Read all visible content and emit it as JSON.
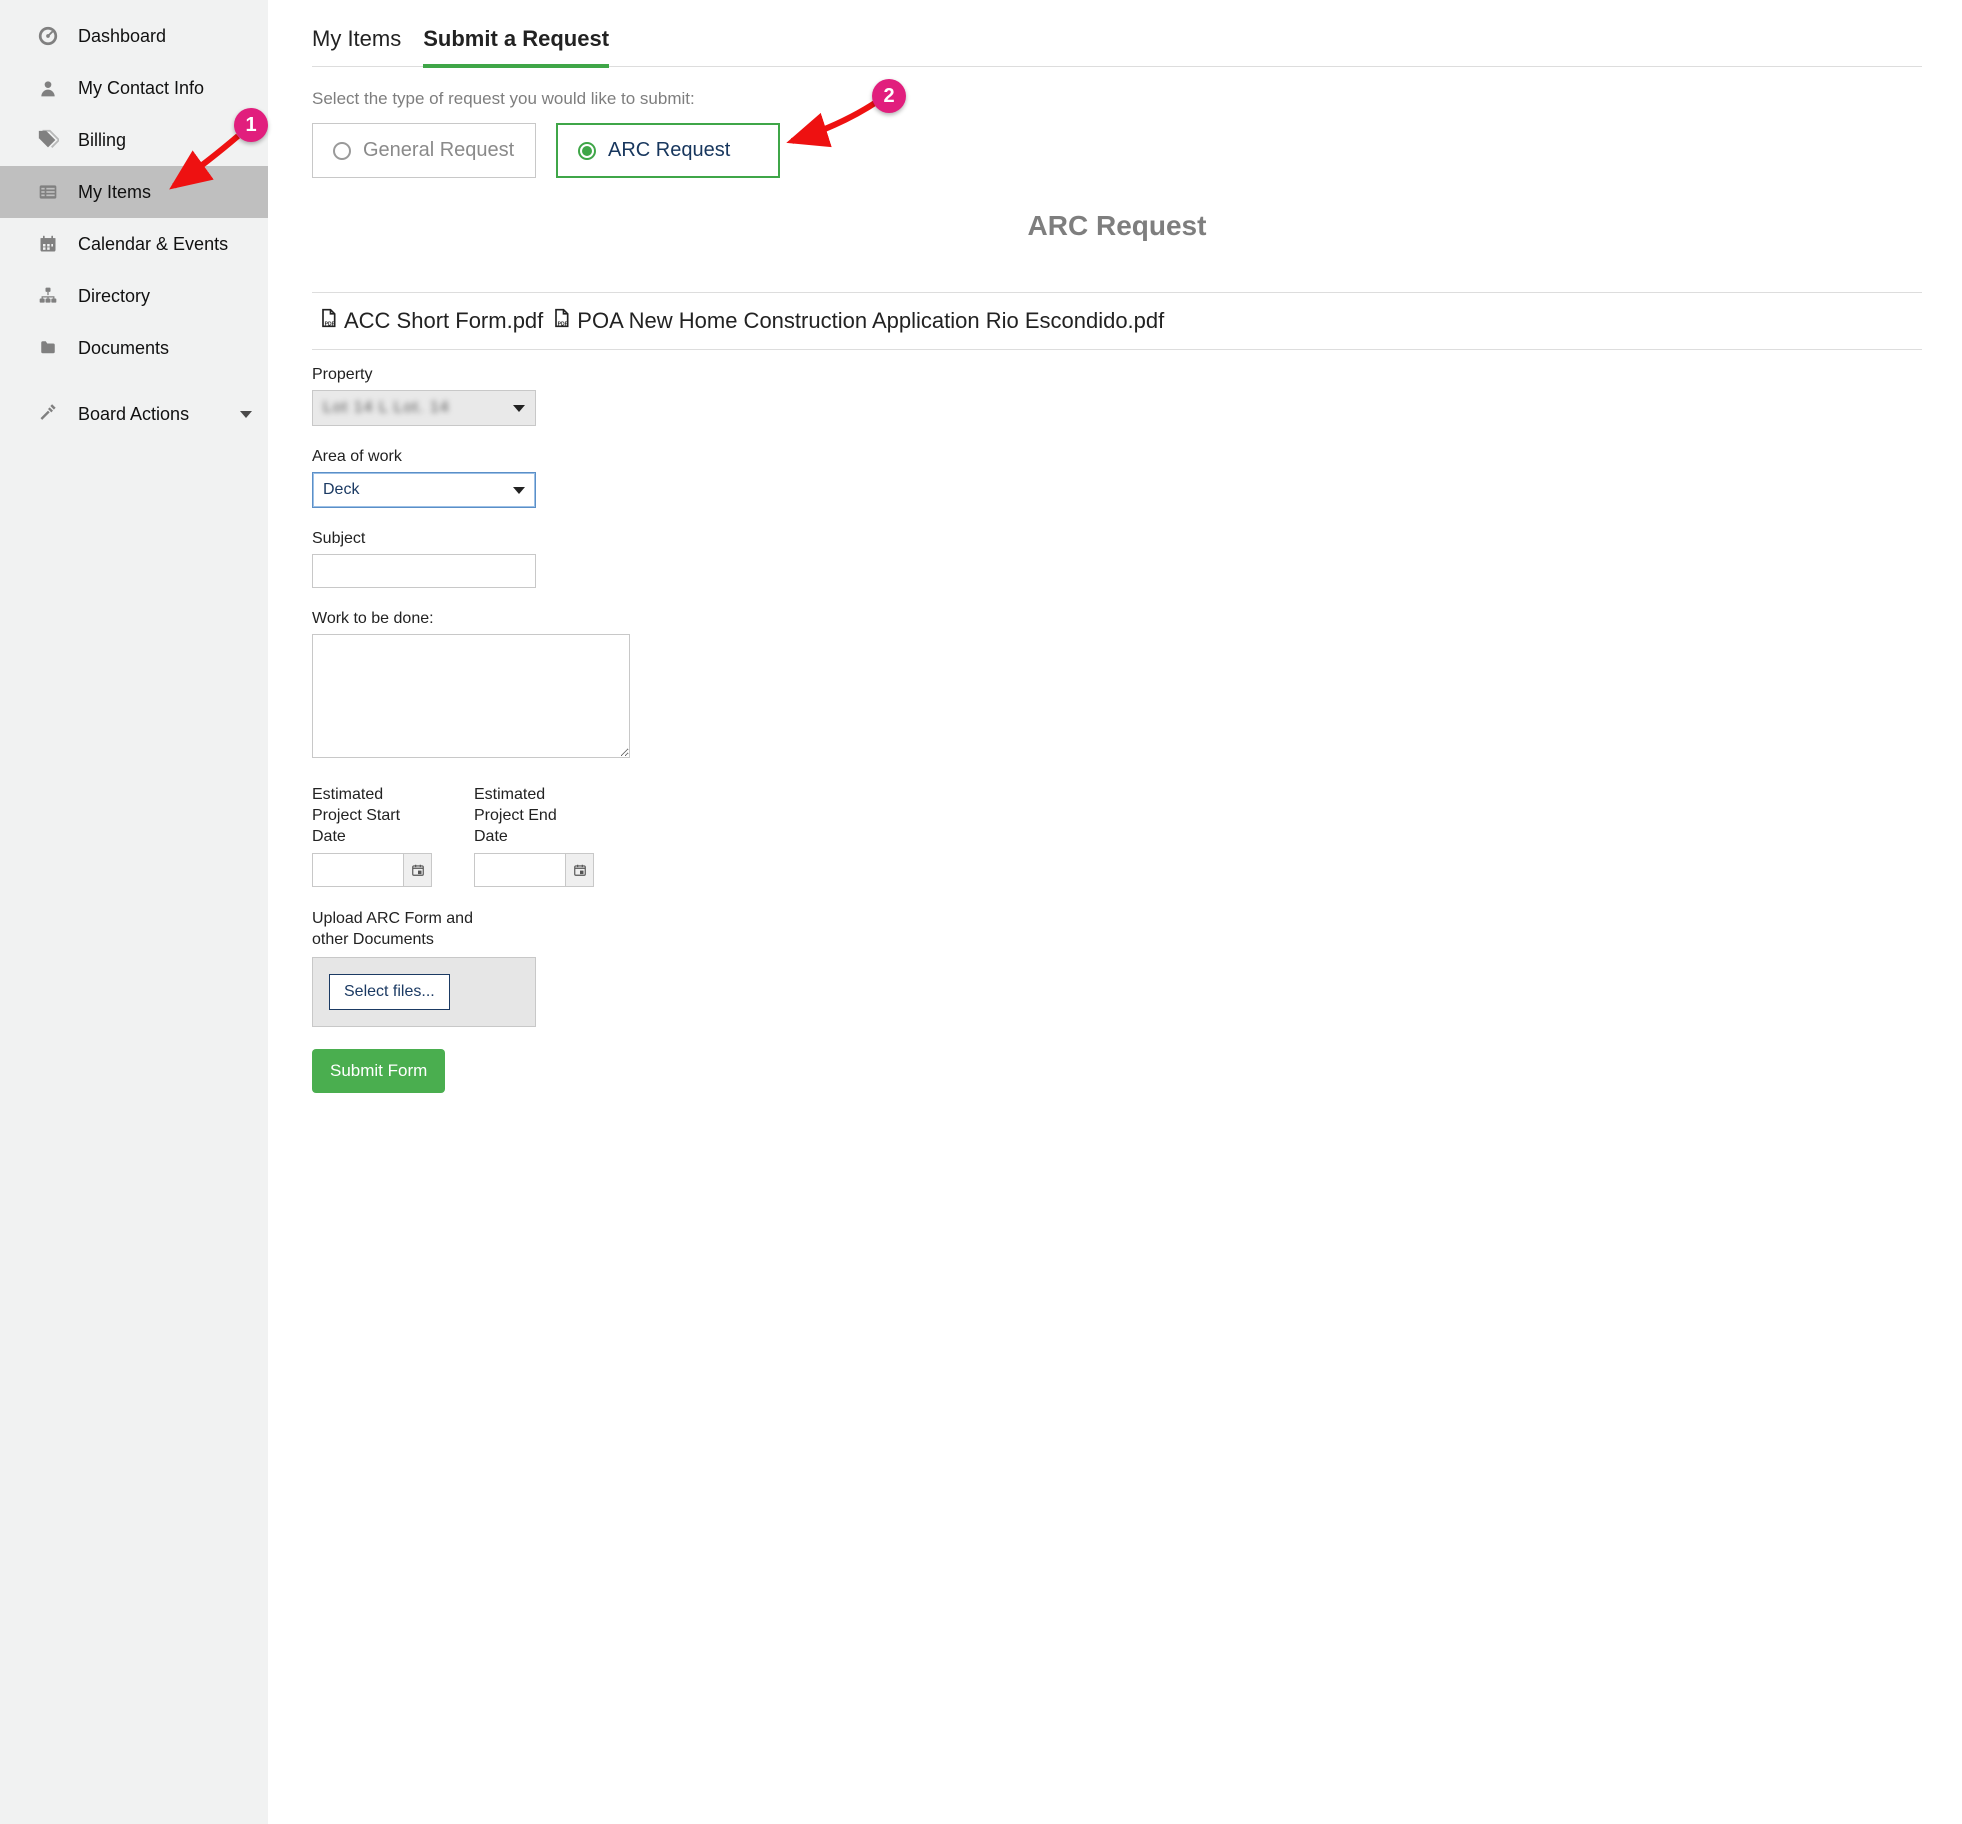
{
  "sidebar": {
    "items": [
      {
        "label": "Dashboard",
        "icon": "gauge"
      },
      {
        "label": "My Contact Info",
        "icon": "user"
      },
      {
        "label": "Billing",
        "icon": "tags"
      },
      {
        "label": "My Items",
        "icon": "list",
        "active": true
      },
      {
        "label": "Calendar & Events",
        "icon": "calendar"
      },
      {
        "label": "Directory",
        "icon": "sitemap"
      },
      {
        "label": "Documents",
        "icon": "folder"
      },
      {
        "label": "Board Actions",
        "icon": "hammer",
        "chevron": true
      }
    ]
  },
  "tabs": {
    "my_items": "My Items",
    "submit": "Submit a Request"
  },
  "form": {
    "helper": "Select the type of request you would like to submit:",
    "options": {
      "general": "General Request",
      "arc": "ARC Request"
    },
    "title": "ARC Request",
    "attachments": {
      "a1": "ACC Short Form.pdf",
      "a2": "POA New Home Construction Application Rio Escondido.pdf"
    },
    "labels": {
      "property": "Property",
      "area": "Area of work",
      "subject": "Subject",
      "work": "Work to be done:",
      "start": "Estimated Project Start Date",
      "end": "Estimated Project End Date",
      "upload": "Upload ARC Form and other Documents",
      "select_files": "Select files...",
      "submit": "Submit Form"
    },
    "values": {
      "property": "Lot 14 L Lot. 14",
      "area": "Deck",
      "subject": "",
      "work": "",
      "start": "",
      "end": ""
    }
  },
  "annotations": {
    "marker1": "1",
    "marker2": "2"
  }
}
